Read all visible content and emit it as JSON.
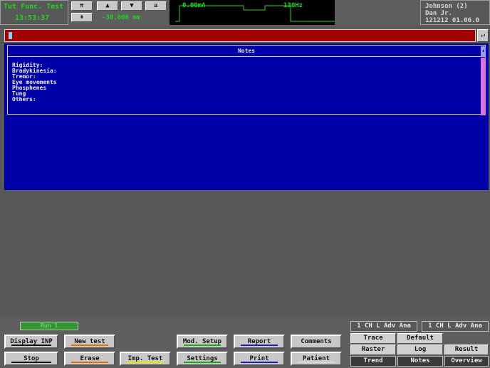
{
  "header": {
    "title": "Tut Func. Test",
    "time": "13:53:37",
    "depth": "-30.000 mm",
    "current": "0.00mA",
    "frequency": "130Hz",
    "patient_name": "Johnson (2)",
    "patient_sub": "Dan Jr.",
    "patient_id_date": "121212  01.06.0"
  },
  "input_bar": {
    "enter_icon": "enter-arrow-icon"
  },
  "notes": {
    "title": "Notes",
    "items": [
      "Rigidity:",
      "Bradykinesia:",
      "Tremor:",
      "Eye movements",
      "Phosphenes",
      "Tung",
      "Others:"
    ]
  },
  "status": {
    "indicator": "Run 1"
  },
  "buttons": {
    "display_inp": "Display INP",
    "new_test": "New test",
    "mod_setup": "Mod. Setup",
    "report": "Report",
    "comments": "Comments",
    "stop": "Stop",
    "erase": "Erase",
    "imp_test": "Imp. Test",
    "settings": "Settings",
    "print": "Print",
    "patient": "Patient"
  },
  "right_panel": {
    "channel_left": "1 CH L Adv Ana",
    "channel_right": "1 CH L Adv Ana",
    "trace": "Trace",
    "default": "Default",
    "raster": "Raster",
    "log": "Log",
    "result": "Result",
    "trend": "Trend",
    "notes": "Notes",
    "overview": "Overview"
  },
  "colors": {
    "accent_green": "#1bd61b",
    "input_red": "#a40000",
    "notes_blue": "#0000a8",
    "underline_orange": "#e07000",
    "underline_yellow": "#e8e800",
    "underline_green": "#10b010",
    "underline_blue": "#2020c0",
    "underline_black": "#101010"
  }
}
